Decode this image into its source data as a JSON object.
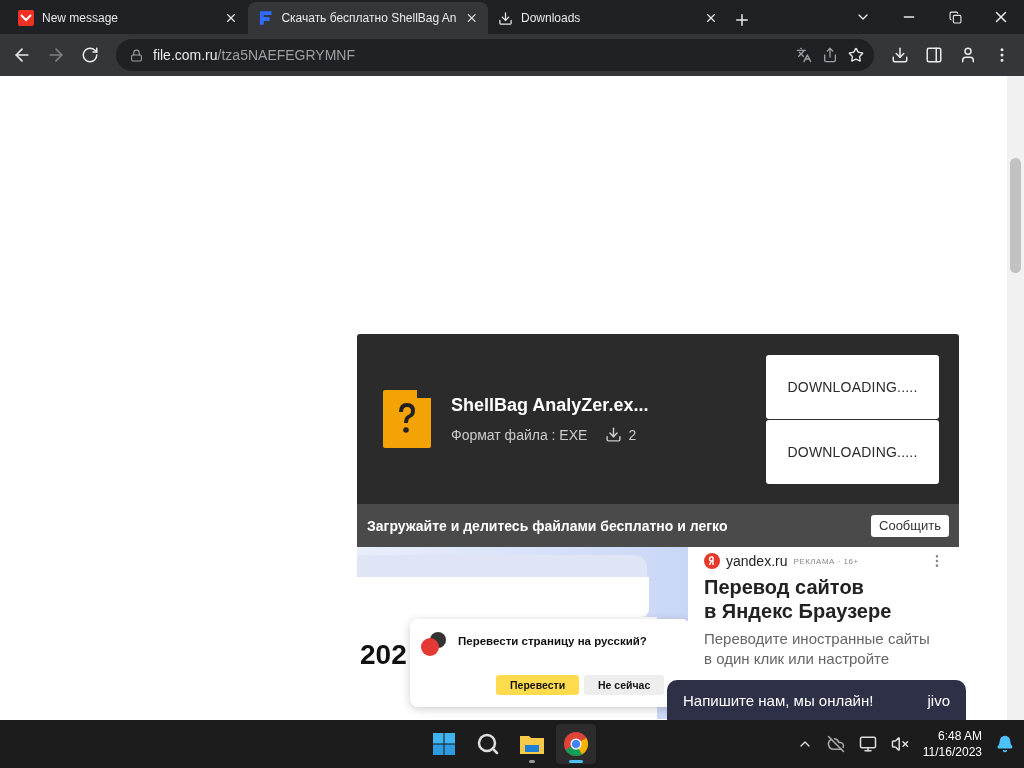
{
  "tabs": [
    {
      "title": "New message",
      "kind": "mail",
      "selected": false
    },
    {
      "title": "Скачать бесплатно ShellBag An",
      "kind": "file",
      "selected": true
    },
    {
      "title": "Downloads",
      "kind": "download",
      "selected": false
    }
  ],
  "address": {
    "host": "file.com.ru",
    "path": "/tza5NAEFEGRYMNF"
  },
  "card": {
    "file_name": "ShellBag AnalyZer.ex...",
    "format": "Формат файла : EXE",
    "downloads": "2",
    "buttons": [
      "DOWNLOADING.....",
      "DOWNLOADING....."
    ]
  },
  "banner": {
    "text": "Загружайте и делитесь файлами бесплатно и легко",
    "button": "Сообщить"
  },
  "ad": {
    "source": "yandex.ru",
    "label": "РЕКЛАМА · 16+",
    "title_lines": [
      "Перевод сайтов",
      "в Яндекс Браузере"
    ],
    "body_lines": [
      "Переводите иностранные сайты",
      "в один клик или настройте"
    ],
    "mockup": {
      "year": "202",
      "prompt": "Перевести страницу на русский?",
      "buttons": [
        "Перевести",
        "Не сейчас"
      ]
    }
  },
  "chat": {
    "text": "Напишите нам, мы онлайн!",
    "brand": "jivo"
  },
  "taskbar": {
    "apps": [
      {
        "kind": "start",
        "active": false
      },
      {
        "kind": "search",
        "active": false
      },
      {
        "kind": "explorer",
        "active": false
      },
      {
        "kind": "chrome",
        "active": true
      }
    ],
    "time": "6:48 AM",
    "date": "11/16/2023"
  }
}
